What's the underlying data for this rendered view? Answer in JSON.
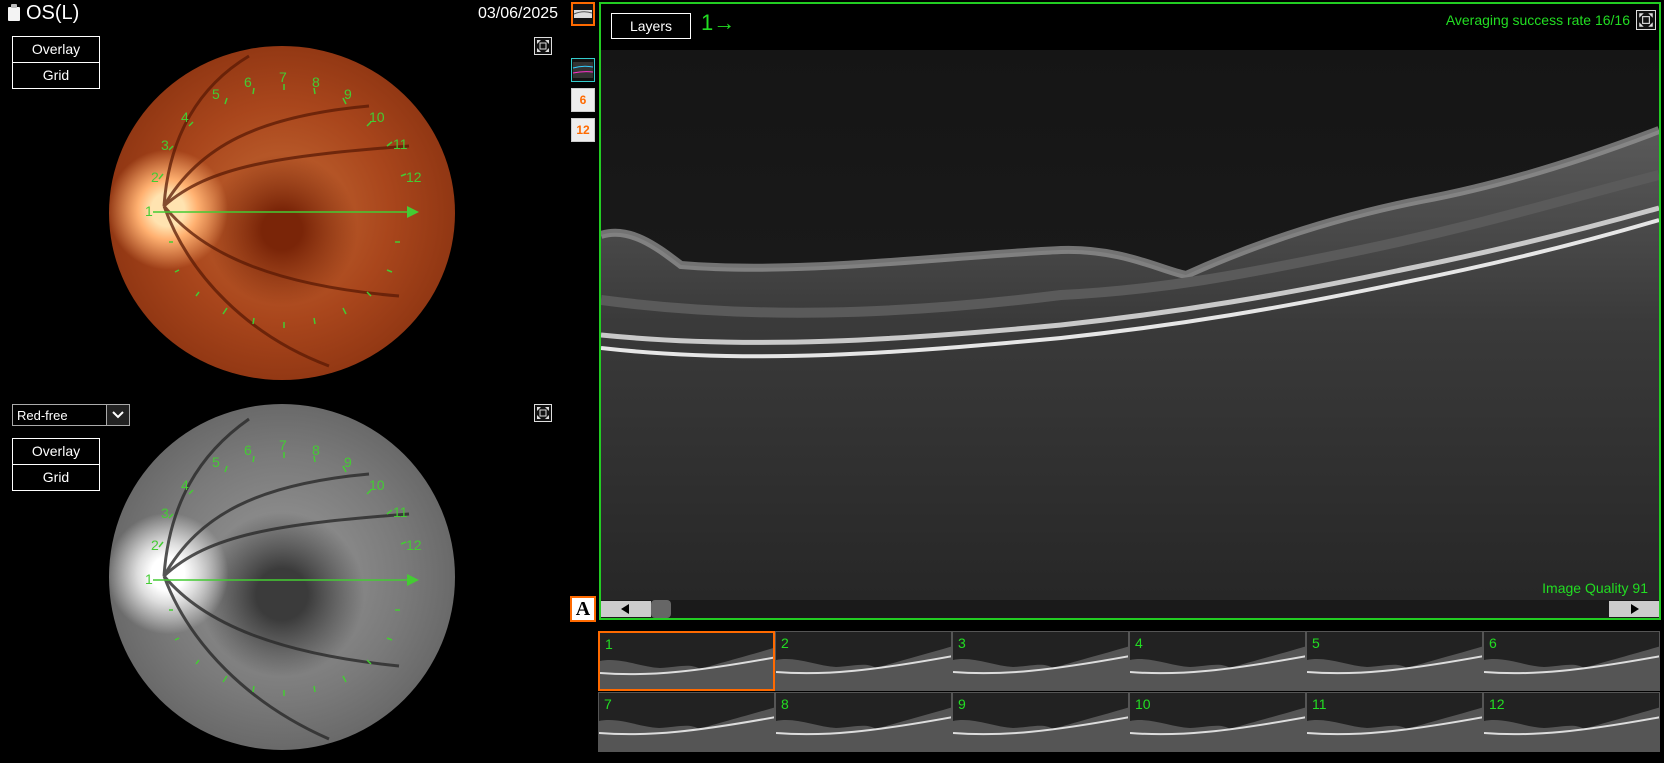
{
  "header": {
    "eye": "OS(L)",
    "date": "03/06/2025"
  },
  "top_fundus": {
    "overlay_label": "Overlay",
    "grid_label": "Grid"
  },
  "bottom_fundus": {
    "filter_selected": "Red-free",
    "overlay_label": "Overlay",
    "grid_label": "Grid"
  },
  "scan_numbers": [
    "1",
    "2",
    "3",
    "4",
    "5",
    "6",
    "7",
    "8",
    "9",
    "10",
    "11",
    "12"
  ],
  "side_tools": {
    "six_label": "6",
    "twelve_label": "12",
    "annotate_label": "A"
  },
  "oct": {
    "layers_label": "Layers",
    "current_scan": "1→",
    "averaging": "Averaging success rate 16/16",
    "image_quality": "Image Quality 91"
  },
  "thumbnails": [
    "1",
    "2",
    "3",
    "4",
    "5",
    "6",
    "7",
    "8",
    "9",
    "10",
    "11",
    "12"
  ],
  "selected_thumbnail": "1",
  "colors": {
    "accent_green": "#22dd22",
    "selection_orange": "#ff6a00"
  }
}
